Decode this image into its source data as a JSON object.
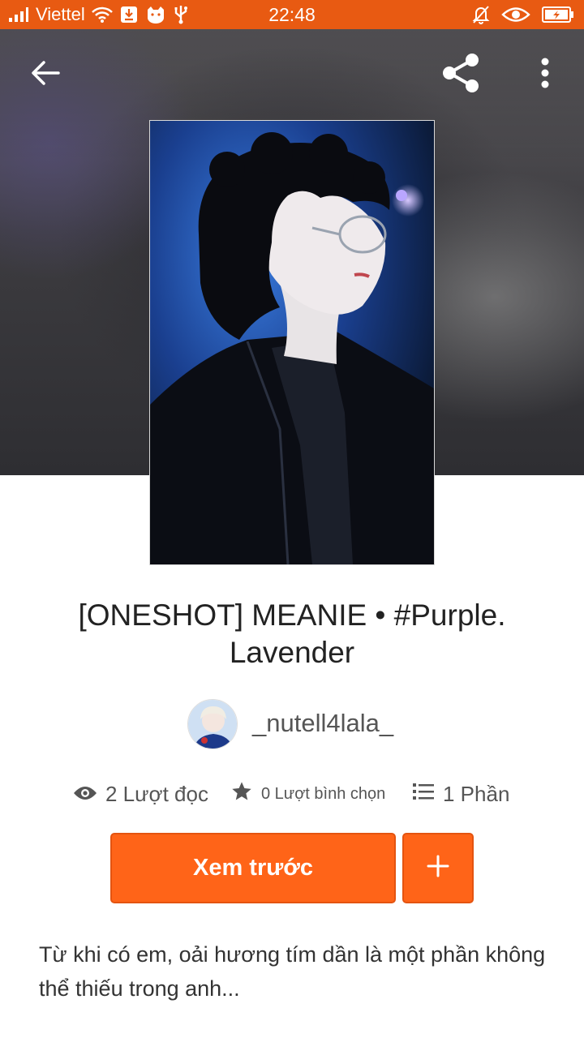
{
  "status_bar": {
    "carrier": "Viettel",
    "time": "22:48"
  },
  "story": {
    "title": "[ONESHOT] MEANIE • #Purple. Lavender",
    "author": "_nutell4lala_",
    "stats": {
      "reads": "2 Lượt đọc",
      "votes": "0 Lượt bình chọn",
      "parts": "1 Phần"
    },
    "description": "Từ khi có em, oải hương tím dần là một phần không thể thiếu trong anh..."
  },
  "actions": {
    "preview_label": "Xem trước",
    "add_label": "+"
  },
  "colors": {
    "status_bar": "#e85a12",
    "accent": "#ff6418"
  },
  "icons": [
    "signal-icon",
    "wifi-icon",
    "notification-icon",
    "cat-icon",
    "usb-icon",
    "bell-off-icon",
    "eye-icon",
    "battery-icon",
    "back-arrow-icon",
    "share-icon",
    "more-vert-icon",
    "views-eye-icon",
    "star-icon",
    "list-icon",
    "plus-icon"
  ]
}
